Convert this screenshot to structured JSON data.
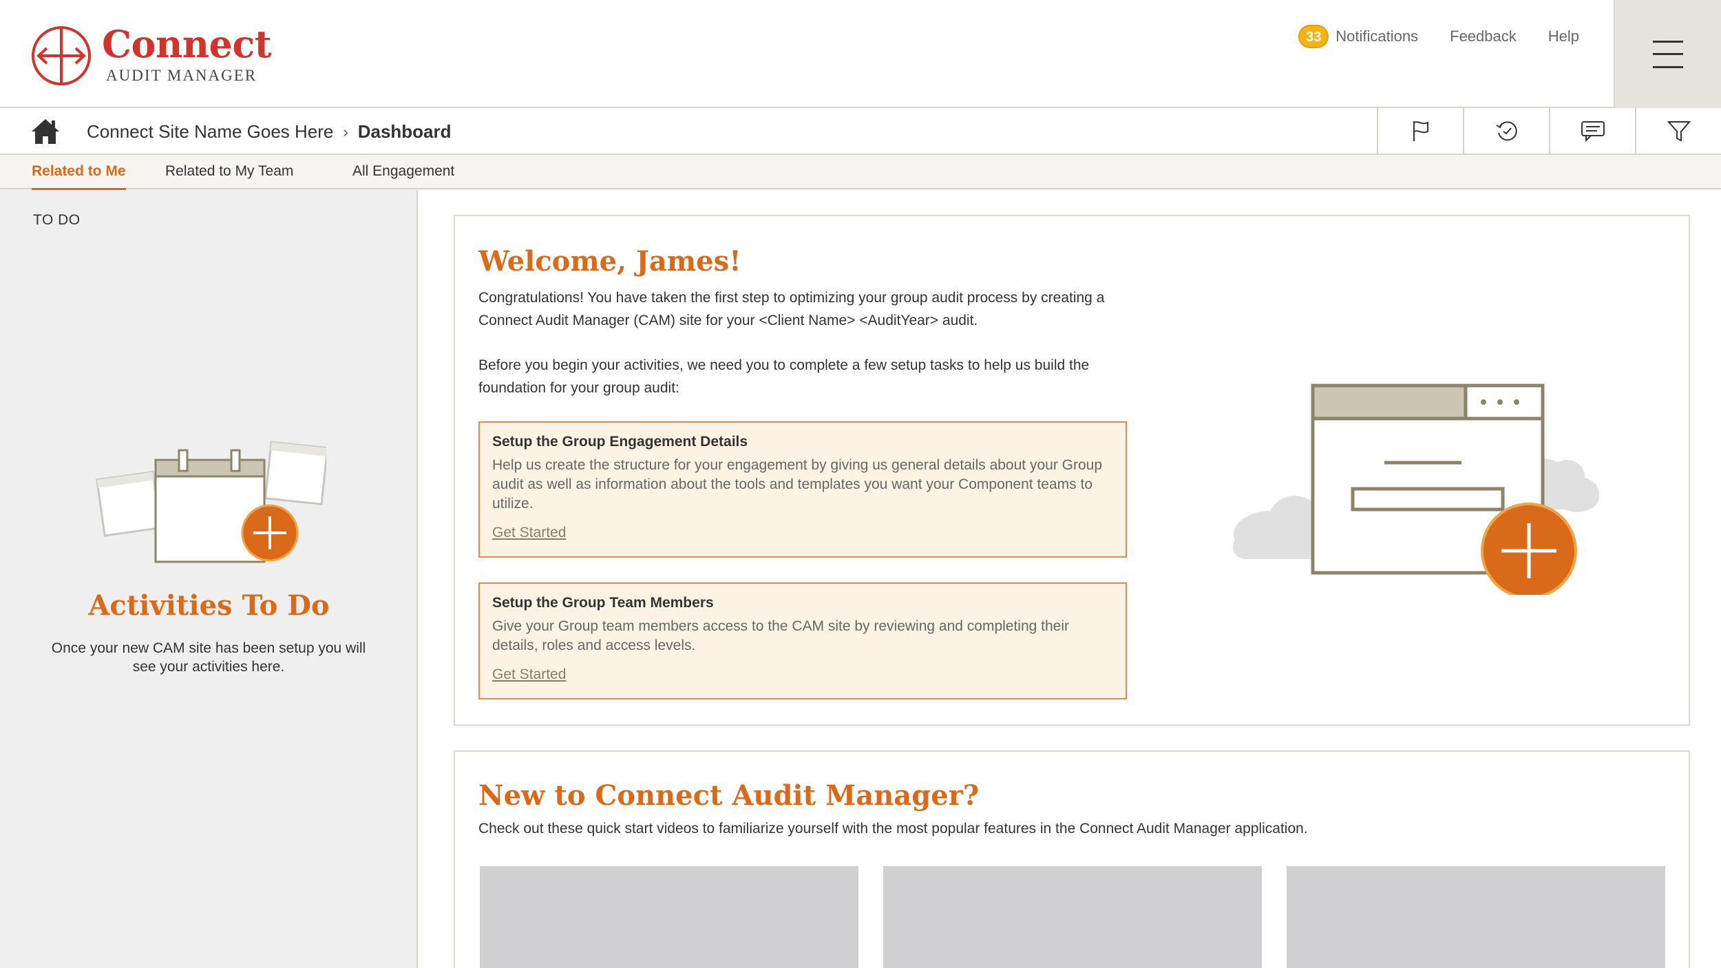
{
  "header": {
    "logo_title": "Connect",
    "logo_subtitle": "AUDIT MANAGER",
    "notifications_count": "33",
    "notifications_label": "Notifications",
    "feedback_label": "Feedback",
    "help_label": "Help",
    "menu_icon": "hamburger-icon"
  },
  "breadcrumb": {
    "home_icon": "home-icon",
    "site_name": "Connect Site Name Goes Here",
    "separator": "›",
    "current": "Dashboard"
  },
  "toolbar": {
    "icons": [
      "flag-icon",
      "history-icon",
      "comment-icon",
      "filter-icon"
    ]
  },
  "tabs": [
    {
      "label": "Related to Me",
      "active": true
    },
    {
      "label": "Related to My Team",
      "active": false
    },
    {
      "label": "All Engagement",
      "active": false
    }
  ],
  "left_panel": {
    "section_label": "TO DO",
    "title": "Activities To Do",
    "text": "Once your new CAM site has been setup you will see your activities here."
  },
  "welcome": {
    "title": "Welcome, James!",
    "paragraph1": "Congratulations!  You have taken the first step to optimizing your group audit process by creating a Connect Audit Manager (CAM) site for your <Client Name> <AuditYear> audit.",
    "paragraph2": "Before you begin your activities, we need you to complete a few setup tasks to help us build the foundation for your group audit:",
    "tasks": [
      {
        "title": "Setup the Group Engagement Details",
        "description": "Help us create the structure for your engagement by giving us general details about your Group audit as well as information about the tools and templates you want your Component teams to utilize.",
        "link": "Get Started"
      },
      {
        "title": "Setup the Group Team Members",
        "description": "Give your Group team members access to the CAM site by reviewing and completing their details, roles and access levels.",
        "link": "Get Started"
      }
    ]
  },
  "new_to": {
    "title": "New to Connect Audit Manager?",
    "text": "Check out these quick start videos to familiarize yourself with the most popular features in the Connect Audit Manager application.",
    "videos": 3
  },
  "colors": {
    "accent_orange": "#d96a19",
    "brand_red": "#d0342c",
    "badge_yellow": "#f4b416",
    "task_bg": "#fdf3e5",
    "panel_bg": "#efefef"
  }
}
